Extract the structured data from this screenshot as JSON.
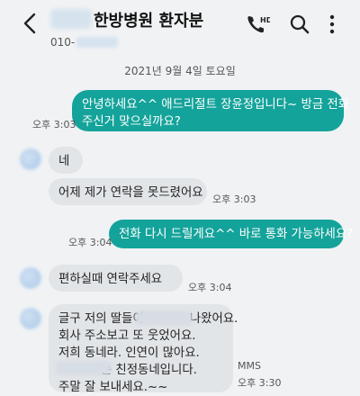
{
  "header": {
    "title": "한방병원 환자분",
    "phone_prefix": "010-",
    "call_icon_label": "HD"
  },
  "date_divider": "2021년 9월 4일 토요일",
  "messages": [
    {
      "direction": "out",
      "text": "안녕하세요^^ 애드리절트 장윤정입니다~ 방금 전화\n주신거 맞으실까요?",
      "time": "오후 3:03"
    },
    {
      "direction": "in",
      "text": "네",
      "time": ""
    },
    {
      "direction": "in",
      "text": "어제 제가 연락을 못드렸어요",
      "time": "오후 3:03"
    },
    {
      "direction": "out",
      "text": "전화 다시 드릴게요^^ 바로 통화 가능하세요?",
      "time": "오후 3:04"
    },
    {
      "direction": "in",
      "text": "편하실때 연락주세요",
      "time": "오후 3:04"
    },
    {
      "direction": "in",
      "text": "글구 저의 딸들이            나왔어요.\n회사 주소보고 또 웃었어요.\n저희 동네라. 인연이 많아요.\n           는 친정동네입니다.\n주말 잘 보내세요.~~",
      "time": "오후 3:30",
      "type_label": "MMS"
    }
  ]
}
